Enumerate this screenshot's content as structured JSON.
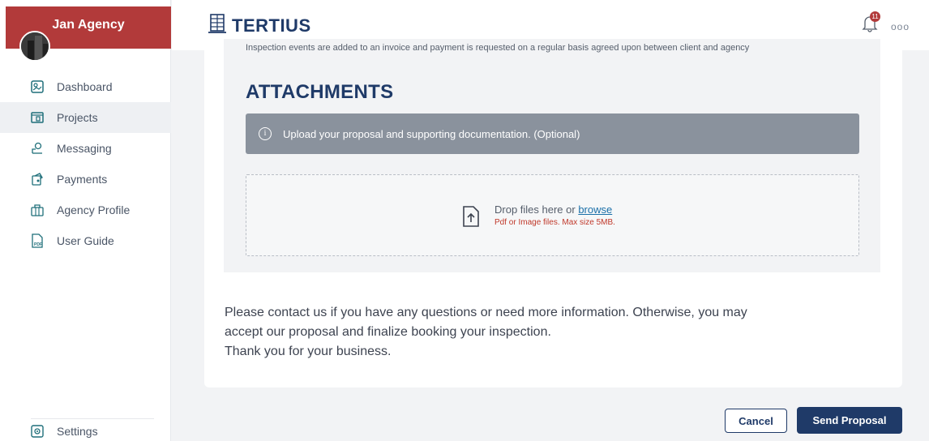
{
  "sidebar": {
    "agency_name": "Jan Agency",
    "items": [
      {
        "label": "Dashboard",
        "icon": "dashboard-icon"
      },
      {
        "label": "Projects",
        "icon": "projects-icon"
      },
      {
        "label": "Messaging",
        "icon": "messaging-icon"
      },
      {
        "label": "Payments",
        "icon": "payments-icon"
      },
      {
        "label": "Agency Profile",
        "icon": "briefcase-icon"
      },
      {
        "label": "User Guide",
        "icon": "pdf-icon"
      }
    ],
    "active_item": "Projects",
    "settings_label": "Settings"
  },
  "header": {
    "logo_text": "TERTIUS",
    "notification_count": "11",
    "more_menu": "ooo"
  },
  "main": {
    "panel_note": "Inspection events are added to an invoice and payment is requested on a regular basis agreed upon between client and agency",
    "attachments_title": "ATTACHMENTS",
    "info_text": "Upload your proposal and supporting documentation. (Optional)",
    "dropzone": {
      "text": "Drop files here or ",
      "browse_link": "browse",
      "hint": "Pdf or Image files. Max size 5MB."
    },
    "closing_lines": [
      "Please contact us if you have any questions or need more information. Otherwise, you may",
      "accept our proposal and finalize booking your inspection.",
      "Thank you for your business."
    ]
  },
  "actions": {
    "cancel_label": "Cancel",
    "send_label": "Send Proposal"
  },
  "colors": {
    "brand_red": "#b23a3a",
    "navy": "#1f3a68",
    "info_gray": "#8a929d"
  }
}
